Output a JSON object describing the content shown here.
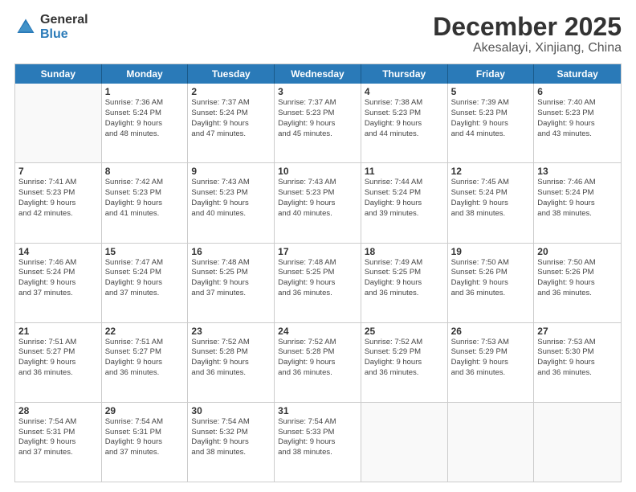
{
  "logo": {
    "general": "General",
    "blue": "Blue"
  },
  "title": "December 2025",
  "subtitle": "Akesalayi, Xinjiang, China",
  "headers": [
    "Sunday",
    "Monday",
    "Tuesday",
    "Wednesday",
    "Thursday",
    "Friday",
    "Saturday"
  ],
  "rows": [
    [
      {
        "day": "",
        "info": ""
      },
      {
        "day": "1",
        "info": "Sunrise: 7:36 AM\nSunset: 5:24 PM\nDaylight: 9 hours\nand 48 minutes."
      },
      {
        "day": "2",
        "info": "Sunrise: 7:37 AM\nSunset: 5:24 PM\nDaylight: 9 hours\nand 47 minutes."
      },
      {
        "day": "3",
        "info": "Sunrise: 7:37 AM\nSunset: 5:23 PM\nDaylight: 9 hours\nand 45 minutes."
      },
      {
        "day": "4",
        "info": "Sunrise: 7:38 AM\nSunset: 5:23 PM\nDaylight: 9 hours\nand 44 minutes."
      },
      {
        "day": "5",
        "info": "Sunrise: 7:39 AM\nSunset: 5:23 PM\nDaylight: 9 hours\nand 44 minutes."
      },
      {
        "day": "6",
        "info": "Sunrise: 7:40 AM\nSunset: 5:23 PM\nDaylight: 9 hours\nand 43 minutes."
      }
    ],
    [
      {
        "day": "7",
        "info": "Sunrise: 7:41 AM\nSunset: 5:23 PM\nDaylight: 9 hours\nand 42 minutes."
      },
      {
        "day": "8",
        "info": "Sunrise: 7:42 AM\nSunset: 5:23 PM\nDaylight: 9 hours\nand 41 minutes."
      },
      {
        "day": "9",
        "info": "Sunrise: 7:43 AM\nSunset: 5:23 PM\nDaylight: 9 hours\nand 40 minutes."
      },
      {
        "day": "10",
        "info": "Sunrise: 7:43 AM\nSunset: 5:23 PM\nDaylight: 9 hours\nand 40 minutes."
      },
      {
        "day": "11",
        "info": "Sunrise: 7:44 AM\nSunset: 5:24 PM\nDaylight: 9 hours\nand 39 minutes."
      },
      {
        "day": "12",
        "info": "Sunrise: 7:45 AM\nSunset: 5:24 PM\nDaylight: 9 hours\nand 38 minutes."
      },
      {
        "day": "13",
        "info": "Sunrise: 7:46 AM\nSunset: 5:24 PM\nDaylight: 9 hours\nand 38 minutes."
      }
    ],
    [
      {
        "day": "14",
        "info": "Sunrise: 7:46 AM\nSunset: 5:24 PM\nDaylight: 9 hours\nand 37 minutes."
      },
      {
        "day": "15",
        "info": "Sunrise: 7:47 AM\nSunset: 5:24 PM\nDaylight: 9 hours\nand 37 minutes."
      },
      {
        "day": "16",
        "info": "Sunrise: 7:48 AM\nSunset: 5:25 PM\nDaylight: 9 hours\nand 37 minutes."
      },
      {
        "day": "17",
        "info": "Sunrise: 7:48 AM\nSunset: 5:25 PM\nDaylight: 9 hours\nand 36 minutes."
      },
      {
        "day": "18",
        "info": "Sunrise: 7:49 AM\nSunset: 5:25 PM\nDaylight: 9 hours\nand 36 minutes."
      },
      {
        "day": "19",
        "info": "Sunrise: 7:50 AM\nSunset: 5:26 PM\nDaylight: 9 hours\nand 36 minutes."
      },
      {
        "day": "20",
        "info": "Sunrise: 7:50 AM\nSunset: 5:26 PM\nDaylight: 9 hours\nand 36 minutes."
      }
    ],
    [
      {
        "day": "21",
        "info": "Sunrise: 7:51 AM\nSunset: 5:27 PM\nDaylight: 9 hours\nand 36 minutes."
      },
      {
        "day": "22",
        "info": "Sunrise: 7:51 AM\nSunset: 5:27 PM\nDaylight: 9 hours\nand 36 minutes."
      },
      {
        "day": "23",
        "info": "Sunrise: 7:52 AM\nSunset: 5:28 PM\nDaylight: 9 hours\nand 36 minutes."
      },
      {
        "day": "24",
        "info": "Sunrise: 7:52 AM\nSunset: 5:28 PM\nDaylight: 9 hours\nand 36 minutes."
      },
      {
        "day": "25",
        "info": "Sunrise: 7:52 AM\nSunset: 5:29 PM\nDaylight: 9 hours\nand 36 minutes."
      },
      {
        "day": "26",
        "info": "Sunrise: 7:53 AM\nSunset: 5:29 PM\nDaylight: 9 hours\nand 36 minutes."
      },
      {
        "day": "27",
        "info": "Sunrise: 7:53 AM\nSunset: 5:30 PM\nDaylight: 9 hours\nand 36 minutes."
      }
    ],
    [
      {
        "day": "28",
        "info": "Sunrise: 7:54 AM\nSunset: 5:31 PM\nDaylight: 9 hours\nand 37 minutes."
      },
      {
        "day": "29",
        "info": "Sunrise: 7:54 AM\nSunset: 5:31 PM\nDaylight: 9 hours\nand 37 minutes."
      },
      {
        "day": "30",
        "info": "Sunrise: 7:54 AM\nSunset: 5:32 PM\nDaylight: 9 hours\nand 38 minutes."
      },
      {
        "day": "31",
        "info": "Sunrise: 7:54 AM\nSunset: 5:33 PM\nDaylight: 9 hours\nand 38 minutes."
      },
      {
        "day": "",
        "info": ""
      },
      {
        "day": "",
        "info": ""
      },
      {
        "day": "",
        "info": ""
      }
    ]
  ]
}
